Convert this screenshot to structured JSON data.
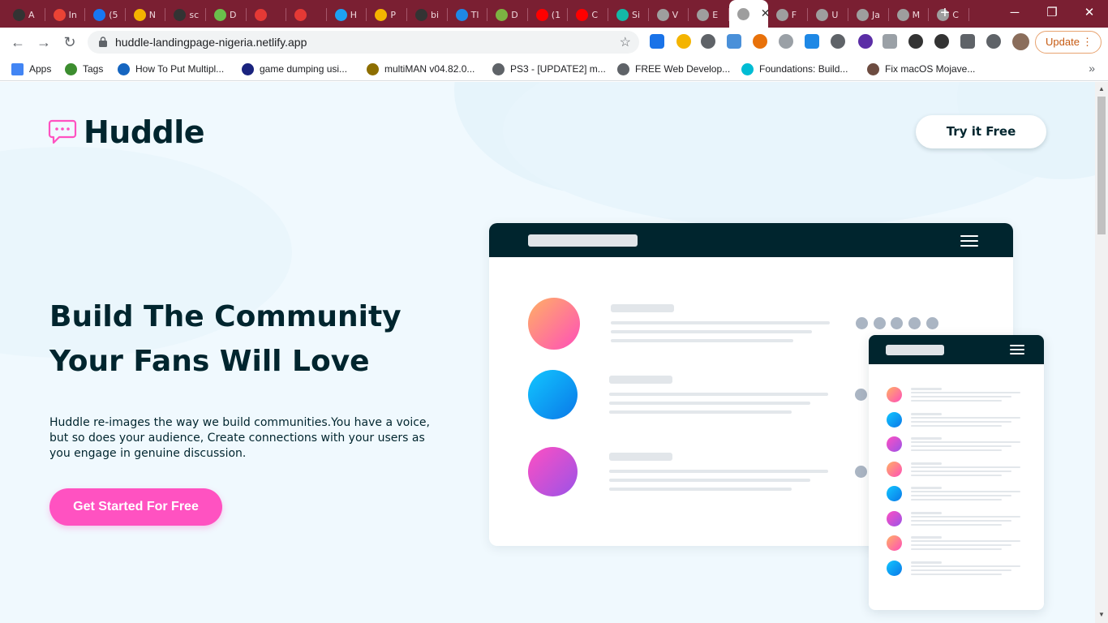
{
  "browser": {
    "tabs": [
      {
        "label": "A",
        "color": "#333333"
      },
      {
        "label": "In",
        "color": "#ea4335"
      },
      {
        "label": "(5",
        "color": "#1877f2"
      },
      {
        "label": "N",
        "color": "#f4b400"
      },
      {
        "label": "sc",
        "color": "#333333"
      },
      {
        "label": "D",
        "color": "#6abf4b"
      },
      {
        "label": "",
        "color": "#e53935"
      },
      {
        "label": "",
        "color": "#e53935"
      },
      {
        "label": "H",
        "color": "#1da1f2"
      },
      {
        "label": "P",
        "color": "#f4b400"
      },
      {
        "label": "bi",
        "color": "#333333"
      },
      {
        "label": "Tl",
        "color": "#1e88e5"
      },
      {
        "label": "D",
        "color": "#7cb342"
      },
      {
        "label": "(1",
        "color": "#ff0000"
      },
      {
        "label": "C",
        "color": "#ff0000"
      },
      {
        "label": "Si",
        "color": "#14b8a6"
      },
      {
        "label": "V",
        "color": "#9e9e9e"
      },
      {
        "label": "E",
        "color": "#9e9e9e"
      },
      {
        "label": "",
        "color": "#9e9e9e",
        "active": true
      },
      {
        "label": "F",
        "color": "#9e9e9e"
      },
      {
        "label": "U",
        "color": "#9e9e9e"
      },
      {
        "label": "Ja",
        "color": "#9e9e9e"
      },
      {
        "label": "M",
        "color": "#9e9e9e"
      },
      {
        "label": "C",
        "color": "#9e9e9e"
      }
    ],
    "active_tab_close": "✕",
    "new_tab": "+",
    "window_controls": {
      "minimize": "─",
      "restore": "❐",
      "close": "✕"
    },
    "nav": {
      "back": "←",
      "forward": "→",
      "reload": "↻"
    },
    "url": "huddle-landingpage-nigeria.netlify.app",
    "star": "☆",
    "update_label": "Update",
    "update_menu": "⋮",
    "extensions": [
      "#1a73e8",
      "#f4b400",
      "#5f6368",
      "#4a90d9",
      "#e8710a",
      "#9aa0a6",
      "#1e88e5",
      "#5f6368",
      "#5b2ea6",
      "#9aa0a6",
      "#333333",
      "#333333",
      "#5f6368",
      "#5f6368"
    ],
    "bookmarks": [
      {
        "label": "Apps",
        "color": "#4285f4"
      },
      {
        "label": "Tags",
        "color": "#3c8d2f"
      },
      {
        "label": "How To Put Multipl...",
        "color": "#1565c0"
      },
      {
        "label": "game dumping usi...",
        "color": "#1a237e"
      },
      {
        "label": "multiMAN v04.82.0...",
        "color": "#8d6e00"
      },
      {
        "label": "PS3 - [UPDATE2] m...",
        "color": "#5f6368"
      },
      {
        "label": "FREE Web Develop...",
        "color": "#5f6368"
      },
      {
        "label": "Foundations: Build...",
        "color": "#00bcd4"
      },
      {
        "label": "Fix macOS Mojave...",
        "color": "#6d4c41"
      }
    ],
    "bookmarks_more": "»"
  },
  "page": {
    "logo": "Huddle",
    "try_button": "Try it Free",
    "headline_line1": "Build The Community",
    "headline_line2": "Your Fans Will Love",
    "description": "Huddle re-images the way we build communities.You have a voice, but so does your audience, Create connections with your users as you engage in genuine discussion.",
    "cta": "Get Started For Free",
    "colors": {
      "dark": "#00252e",
      "pink": "#ff52c1",
      "background": "#f0f9fe"
    }
  }
}
